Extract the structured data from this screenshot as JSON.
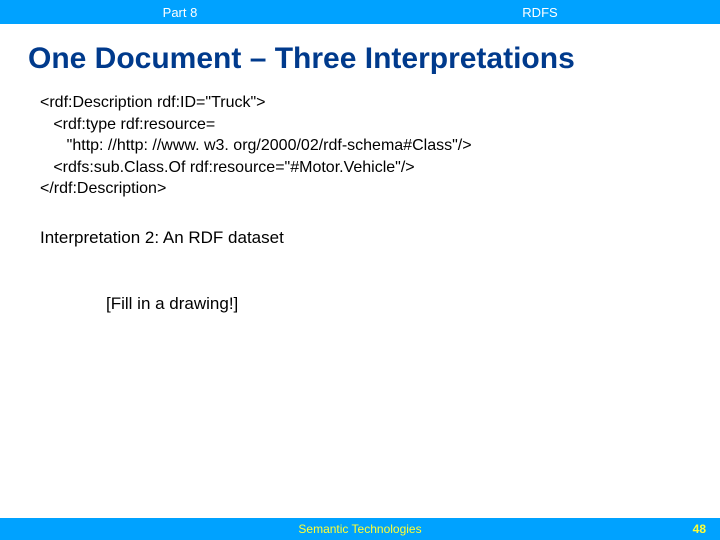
{
  "header": {
    "left": "Part 8",
    "right": "RDFS"
  },
  "title": "One Document –  Three Interpretations",
  "code": "<rdf:Description rdf:ID=\"Truck\">\n   <rdf:type rdf:resource=\n      \"http: //http: //www. w3. org/2000/02/rdf-schema#Class\"/>\n   <rdfs:sub.Class.Of rdf:resource=\"#Motor.Vehicle\"/>\n</rdf:Description>",
  "interpretation": "Interpretation 2: An RDF dataset",
  "placeholder": "[Fill in a drawing!]",
  "footer": {
    "title": "Semantic Technologies",
    "page": "48"
  }
}
